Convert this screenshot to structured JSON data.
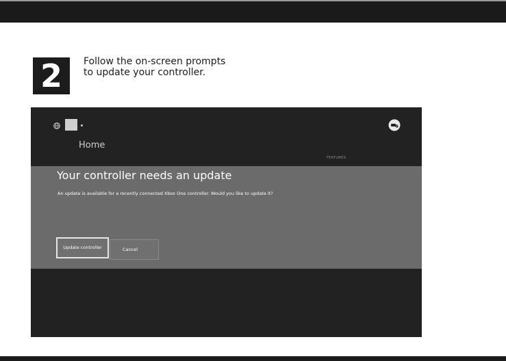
{
  "step": {
    "number": "2",
    "line1": "Follow the on-screen prompts",
    "line2": "to update your controller."
  },
  "screen": {
    "home_label": "Home",
    "featured_label": "FEATURED",
    "icons": {
      "left": [
        "globe-icon",
        "avatar",
        "dot-icon"
      ],
      "right": "controller-icon"
    },
    "dialog": {
      "title": "Your controller needs an update",
      "message": "An update is available for a recently connected Xbox One controller. Would you like to update it?",
      "update_button": "Update controller",
      "cancel_button": "Cancel"
    }
  },
  "colors": {
    "bar": "#1a1a1a",
    "screen_bg": "#222222",
    "dialog_bg": "#6b6b6b",
    "text_light": "#ffffff"
  }
}
